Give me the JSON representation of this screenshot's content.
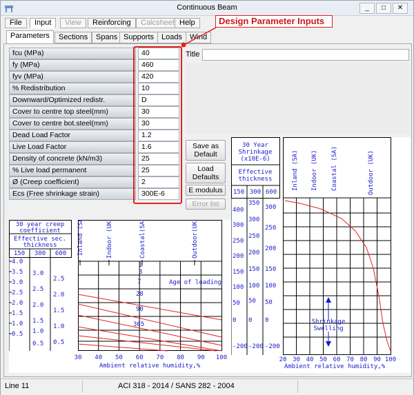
{
  "window": {
    "title": "Continuous Beam"
  },
  "menu": [
    "File",
    "Input",
    "View",
    "Reinforcing",
    "Calcsheet",
    "Help"
  ],
  "tabs": [
    "Parameters",
    "Sections",
    "Spans",
    "Supports",
    "Loads",
    "Wind"
  ],
  "annotation": "Design Parameter Inputs",
  "params": [
    {
      "label": "fcu (MPa)",
      "value": "40"
    },
    {
      "label": "fy  (MPa)",
      "value": "460"
    },
    {
      "label": "fyv (MPa)",
      "value": "420"
    },
    {
      "label": "% Redistribution",
      "value": "10"
    },
    {
      "label": "Downward/Optimized redistr.",
      "value": "D"
    },
    {
      "label": "Cover to centre top steel(mm)",
      "value": "30"
    },
    {
      "label": "Cover to centre bot.steel(mm)",
      "value": "30"
    },
    {
      "label": "Dead Load Factor",
      "value": "1.2"
    },
    {
      "label": "Live Load Factor",
      "value": "1.6"
    },
    {
      "label": "Density of concrete (kN/m3)",
      "value": "25"
    },
    {
      "label": "% Live load permanent",
      "value": "25"
    },
    {
      "label": "Ø  (Creep coefficient)",
      "value": "2"
    },
    {
      "label": "Ecs (Free shrinkage strain)",
      "value": "300E-6"
    }
  ],
  "title_label": "Title",
  "title_value": "",
  "buttons": {
    "save_default": "Save as Default",
    "load_defaults": "Load Defaults",
    "emodulus": "E modulus",
    "error_list": "Error list"
  },
  "creep_chart": {
    "title": "30 year creep coefficient",
    "subtitle": "Effective sec. thickness",
    "thickness": [
      "150",
      "300",
      "600"
    ],
    "col1": [
      "4.0",
      "3.5",
      "3.0",
      "2.5",
      "2.0",
      "1.5",
      "1.0",
      "0.5"
    ],
    "col2": [
      "3.0",
      "2.5",
      "2.0",
      "1.5",
      "1.0",
      "0.5"
    ],
    "col3": [
      "2.5",
      "2.0",
      "1.5",
      "1.0",
      "0.5"
    ],
    "env": [
      "Inland (SA)",
      "Indoor (UK)",
      "Coastal(SA)",
      "Outdoor(UK)"
    ],
    "ages": [
      "1",
      "3",
      "7",
      "28",
      "90",
      "365"
    ],
    "age_label": "Age of loading",
    "x_ticks": [
      "30",
      "40",
      "50",
      "60",
      "70",
      "80",
      "90",
      "100"
    ],
    "xlabel": "Ambient relative humidity,%"
  },
  "shrink_chart": {
    "title": "30 Year Shrinkage (x10E-6)",
    "subtitle": "Effective thickness",
    "thickness": [
      "150",
      "300",
      "600"
    ],
    "col1": [
      "400",
      "300",
      "250",
      "200",
      "150",
      "100",
      "50",
      "0",
      "-200"
    ],
    "col2": [
      "350",
      "300",
      "250",
      "200",
      "150",
      "100",
      "50",
      "0",
      "-200"
    ],
    "col3": [
      "300",
      "250",
      "200",
      "150",
      "100",
      "50",
      "0",
      "-200"
    ],
    "env": [
      "Inland (SA)",
      "Indoor (UK)",
      "Coastal (SA)",
      "Outdoor (UK)"
    ],
    "shrinkage_label": "Shrinkage",
    "swelling_label": "Swelling",
    "x_ticks": [
      "20",
      "30",
      "40",
      "50",
      "60",
      "70",
      "80",
      "90",
      "100"
    ],
    "xlabel": "Ambient relative humidity,%"
  },
  "status": {
    "line": "Line 11",
    "codes": "ACI 318 - 2014   / SANS 282 - 2004"
  }
}
